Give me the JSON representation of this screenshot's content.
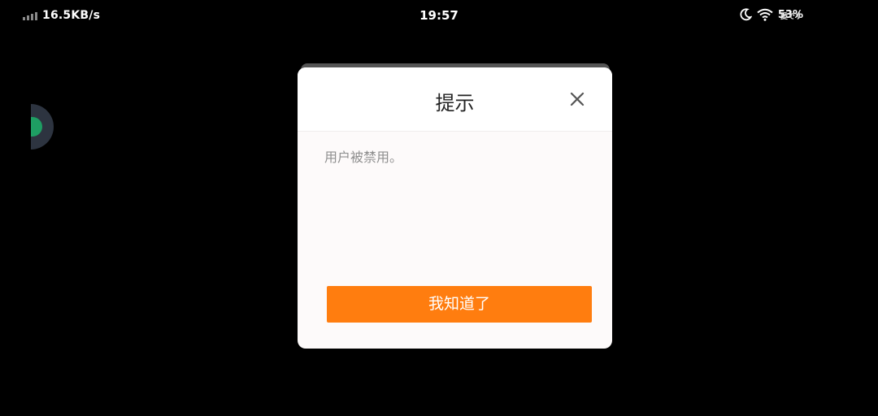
{
  "status_bar": {
    "network_speed": "16.5KB/s",
    "time": "19:57",
    "battery": "53%",
    "extra_text": "愛です",
    "icons": [
      "signal-icon",
      "moon-icon",
      "wifi-icon"
    ]
  },
  "dialog": {
    "title": "提示",
    "message": "用户被禁用。",
    "confirm_label": "我知道了",
    "close_icon": "close-icon"
  },
  "colors": {
    "background": "#000000",
    "dialog_bg": "#fdfafa",
    "accent": "#ff7d0f",
    "floating_widget": "#1e9e63"
  }
}
